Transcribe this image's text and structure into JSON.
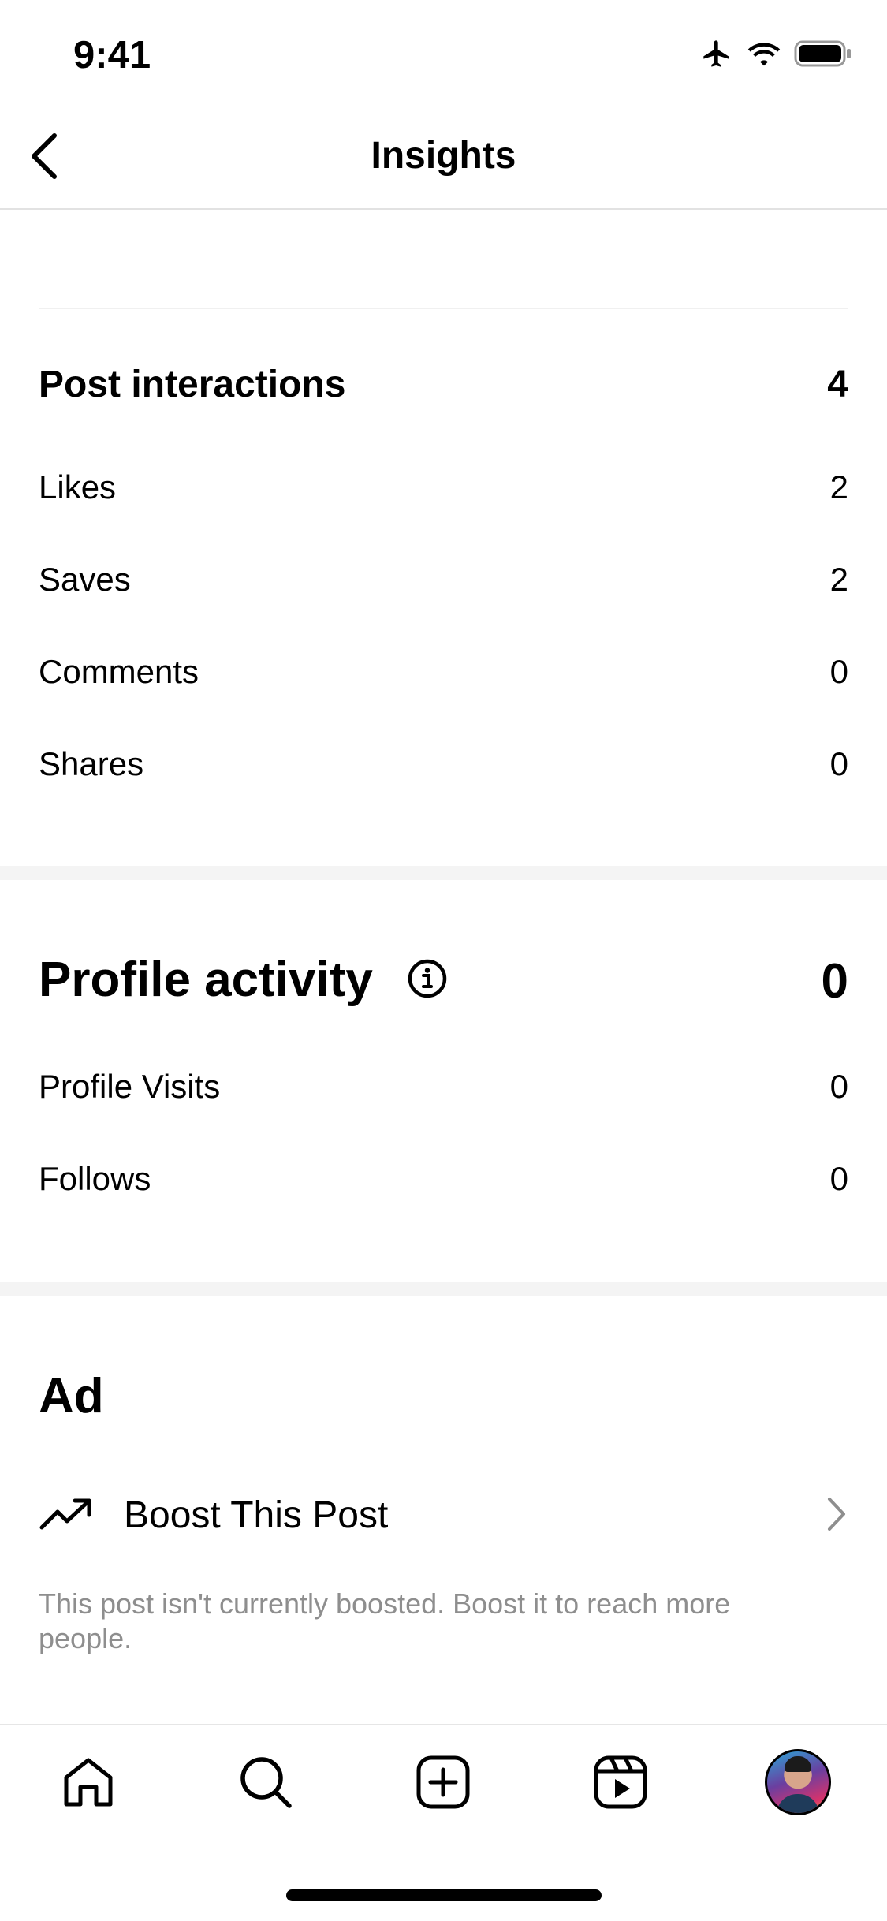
{
  "status_bar": {
    "time": "9:41"
  },
  "nav": {
    "title": "Insights",
    "back_icon": "chevron-left-icon"
  },
  "post_interactions": {
    "title": "Post interactions",
    "total": "4",
    "rows": [
      {
        "label": "Likes",
        "value": "2"
      },
      {
        "label": "Saves",
        "value": "2"
      },
      {
        "label": "Comments",
        "value": "0"
      },
      {
        "label": "Shares",
        "value": "0"
      }
    ]
  },
  "profile_activity": {
    "title": "Profile activity",
    "total": "0",
    "info_icon": "info-circle-icon",
    "rows": [
      {
        "label": "Profile Visits",
        "value": "0"
      },
      {
        "label": "Follows",
        "value": "0"
      }
    ]
  },
  "ad": {
    "title": "Ad",
    "boost_label": "Boost This Post",
    "boost_icon": "trending-up-icon",
    "boost_note": "This post isn't currently boosted. Boost it to reach more people."
  },
  "tabbar": {
    "items": [
      "home-icon",
      "search-icon",
      "create-icon",
      "reels-icon",
      "profile-avatar"
    ]
  },
  "colors": {
    "text": "#000000",
    "secondary_text": "#8e8e8e",
    "divider": "#e2e2e2",
    "section_gap": "#f4f4f4"
  }
}
